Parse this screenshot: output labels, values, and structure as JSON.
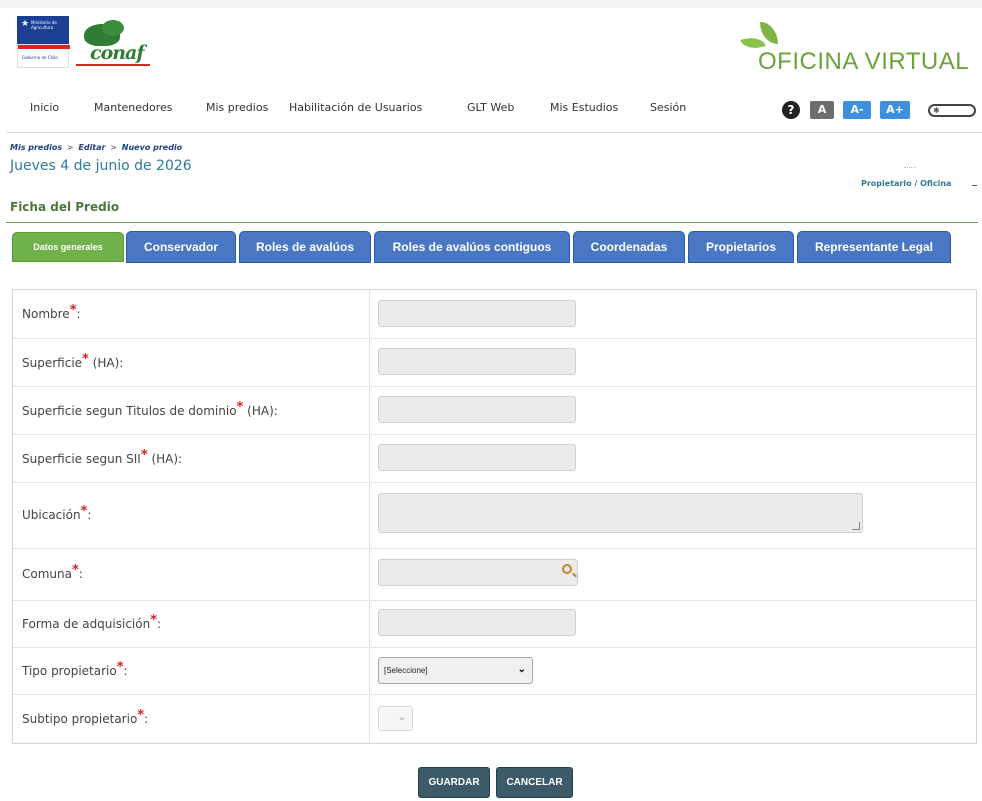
{
  "header": {
    "gob_logo_text": "Ministerio de Agricultura",
    "gob_logo_sub": "Gobierno de Chile",
    "conaf_logo_text": "conaf",
    "virtual_office_logo": "OFICINA VIRTUAL"
  },
  "nav": {
    "items": [
      {
        "label": "Inicio"
      },
      {
        "label": "Mantenedores"
      },
      {
        "label": "Mis predios"
      },
      {
        "label": "Habilitación de Usuarios"
      },
      {
        "label": "GLT Web"
      },
      {
        "label": "Mis Estudios"
      },
      {
        "label": "Sesión"
      }
    ]
  },
  "accessibility": {
    "help_icon": "question-mark-icon",
    "help_label": "?",
    "font_normal": "A",
    "font_smaller": "A-",
    "font_larger": "A+",
    "contrast_toggle_icon": "sun-icon",
    "contrast_symbol": "✱"
  },
  "breadcrumb": {
    "items": [
      "Mis predios",
      "Editar",
      "Nuevo predio"
    ],
    "separator": ">"
  },
  "date": "Jueves 4 de junio de 2026",
  "user_role": "Propietario / Oficina",
  "section_title": "Ficha del Predio",
  "tabs": [
    {
      "label": "Datos generales",
      "active": true
    },
    {
      "label": "Conservador"
    },
    {
      "label": "Roles de avalúos"
    },
    {
      "label": "Roles de avalúos contiguos"
    },
    {
      "label": "Coordenadas"
    },
    {
      "label": "Propietarios"
    },
    {
      "label": "Representante Legal"
    }
  ],
  "form": {
    "required_marker": "*",
    "fields": [
      {
        "label": "Nombre",
        "suffix": ":",
        "type": "text",
        "value": ""
      },
      {
        "label": "Superficie",
        "suffix": " (HA):",
        "type": "text",
        "value": ""
      },
      {
        "label": "Superficie segun Titulos de dominio",
        "suffix": " (HA):",
        "type": "text",
        "value": ""
      },
      {
        "label": "Superficie segun SII",
        "suffix": " (HA):",
        "type": "text",
        "value": ""
      },
      {
        "label": "Ubicación",
        "suffix": ":",
        "type": "textarea",
        "value": ""
      },
      {
        "label": "Comuna",
        "suffix": ":",
        "type": "search",
        "value": "",
        "icon": "magnifier-icon"
      },
      {
        "label": "Forma de adquisición",
        "suffix": ":",
        "type": "text",
        "value": ""
      },
      {
        "label": "Tipo propietario",
        "suffix": ":",
        "type": "select",
        "value": "[Seleccione]"
      },
      {
        "label": "Subtipo propietario",
        "suffix": ":",
        "type": "select-disabled",
        "value": ""
      }
    ]
  },
  "actions": {
    "save_label": "GUARDAR",
    "cancel_label": "CANCELAR"
  },
  "colors": {
    "tab_blue": "#4a77c3",
    "tab_active_green": "#6fb14a",
    "button": "#3c5a68",
    "required_red": "#d61f26",
    "date_teal": "#2f7a97"
  }
}
